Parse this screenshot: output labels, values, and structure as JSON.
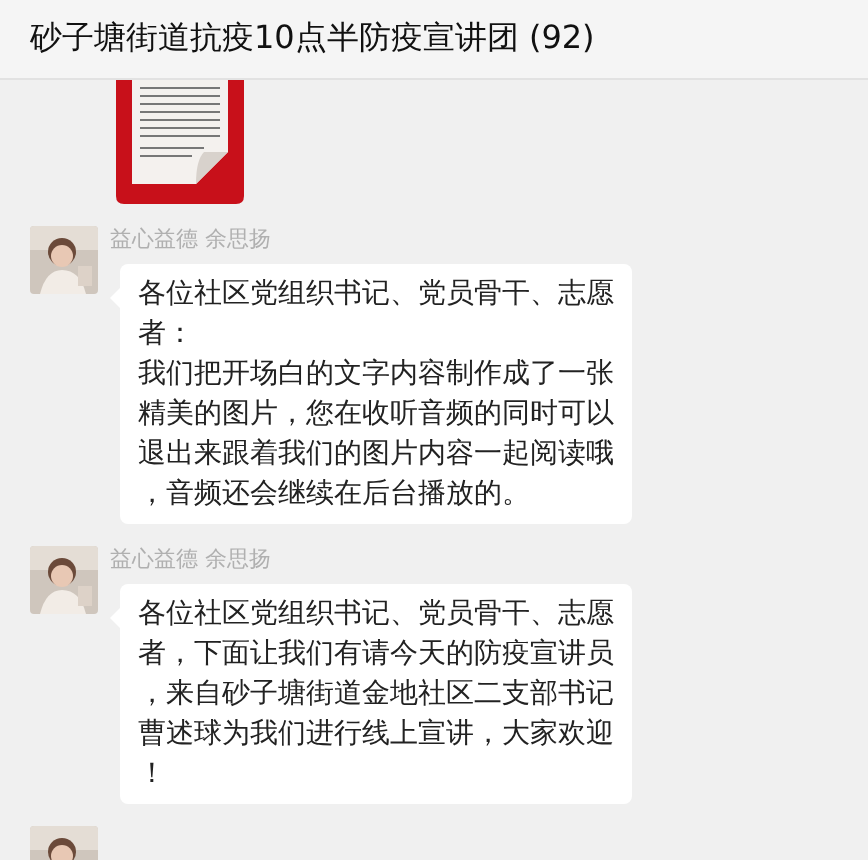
{
  "header": {
    "title": "砂子塘街道抗疫10点半防疫宣讲团 (92)"
  },
  "messages": [
    {
      "kind": "document"
    },
    {
      "kind": "text",
      "sender": "益心益德 余思扬",
      "paragraphs": [
        "各位社区党组织书记、党员骨干、志愿者：",
        "我们把开场白的文字内容制作成了一张精美的图片，您在收听音频的同时可以退出来跟着我们的图片内容一起阅读哦，音频还会继续在后台播放的。"
      ]
    },
    {
      "kind": "text",
      "sender": "益心益德 余思扬",
      "paragraphs": [
        "各位社区党组织书记、党员骨干、志愿者，下面让我们有请今天的防疫宣讲员，来自砂子塘街道金地社区二支部书记曹述球为我们进行线上宣讲，大家欢迎！"
      ]
    },
    {
      "kind": "cut"
    }
  ]
}
